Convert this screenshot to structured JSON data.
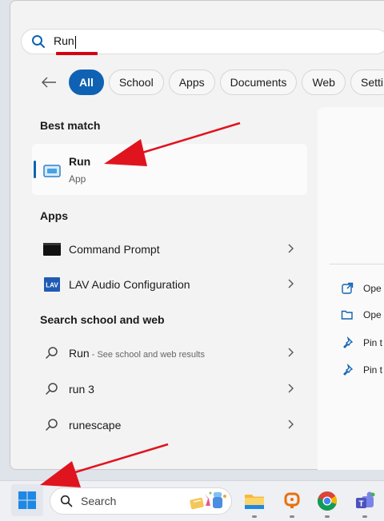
{
  "search": {
    "query": "Run"
  },
  "filters": [
    "All",
    "School",
    "Apps",
    "Documents",
    "Web",
    "Setti"
  ],
  "best_match": {
    "header": "Best match",
    "title": "Run",
    "subtitle": "App"
  },
  "apps": {
    "header": "Apps",
    "items": [
      "Command Prompt",
      "LAV Audio Configuration"
    ]
  },
  "web": {
    "header": "Search school and web",
    "items": [
      {
        "label": "Run",
        "sub": " - See school and web results"
      },
      {
        "label": "run 3",
        "sub": ""
      },
      {
        "label": "runescape",
        "sub": ""
      }
    ]
  },
  "actions": [
    "Ope",
    "Ope",
    "Pin t",
    "Pin t"
  ],
  "taskbar": {
    "search_label": "Search"
  },
  "colors": {
    "accent": "#0f62b3",
    "annotation": "#e0141e"
  }
}
